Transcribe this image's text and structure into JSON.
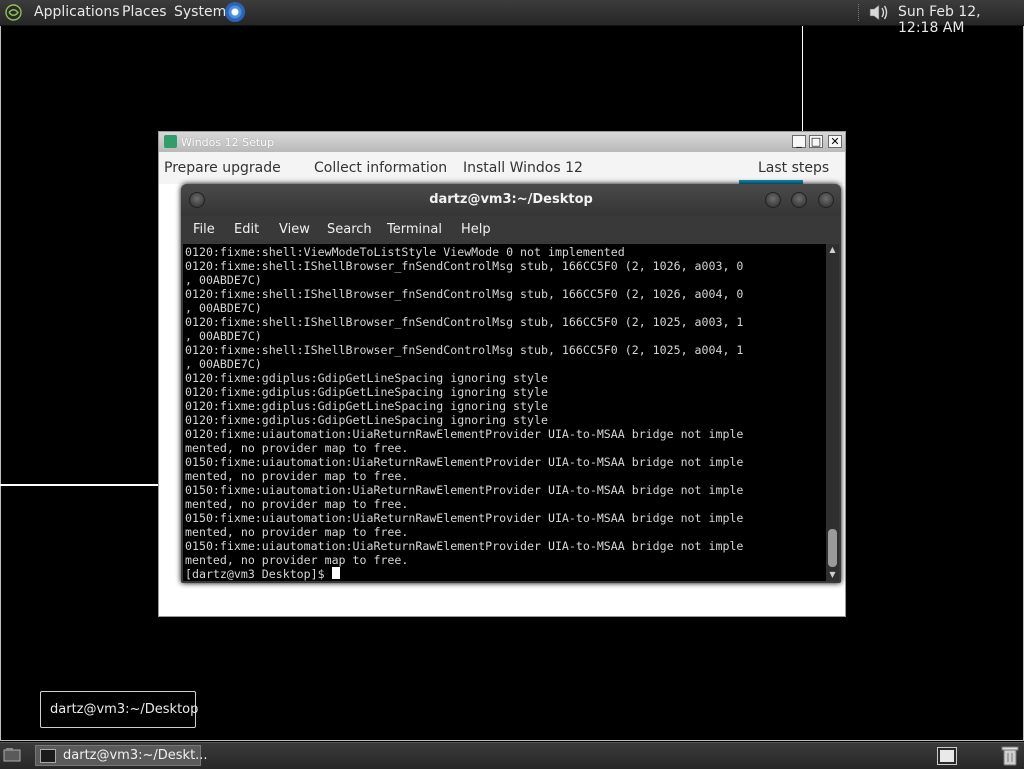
{
  "top_panel": {
    "menus": [
      "Applications",
      "Places",
      "System"
    ],
    "clock": "Sun Feb 12, 12:18 AM",
    "icons": [
      "mate-logo-icon",
      "browser-icon",
      "volume-icon"
    ]
  },
  "setup_window": {
    "title": "Windos 12 Setup",
    "steps": [
      "Prepare upgrade",
      "Collect information",
      "Install Windos 12",
      "Last steps"
    ],
    "active_step_index": 3,
    "buttons": {
      "minimize": "_",
      "maximize": "□",
      "close": "✕"
    }
  },
  "terminal": {
    "title": "dartz@vm3:~/Desktop",
    "menu": [
      "File",
      "Edit",
      "View",
      "Search",
      "Terminal",
      "Help"
    ],
    "lines": [
      "0120:fixme:shell:ViewModeToListStyle ViewMode 0 not implemented",
      "0120:fixme:shell:IShellBrowser_fnSendControlMsg stub, 166CC5F0 (2, 1026, a003, 0",
      ", 00ABDE7C)",
      "0120:fixme:shell:IShellBrowser_fnSendControlMsg stub, 166CC5F0 (2, 1026, a004, 0",
      ", 00ABDE7C)",
      "0120:fixme:shell:IShellBrowser_fnSendControlMsg stub, 166CC5F0 (2, 1025, a003, 1",
      ", 00ABDE7C)",
      "0120:fixme:shell:IShellBrowser_fnSendControlMsg stub, 166CC5F0 (2, 1025, a004, 1",
      ", 00ABDE7C)",
      "0120:fixme:gdiplus:GdipGetLineSpacing ignoring style",
      "0120:fixme:gdiplus:GdipGetLineSpacing ignoring style",
      "0120:fixme:gdiplus:GdipGetLineSpacing ignoring style",
      "0120:fixme:gdiplus:GdipGetLineSpacing ignoring style",
      "0120:fixme:uiautomation:UiaReturnRawElementProvider UIA-to-MSAA bridge not imple",
      "mented, no provider map to free.",
      "0150:fixme:uiautomation:UiaReturnRawElementProvider UIA-to-MSAA bridge not imple",
      "mented, no provider map to free.",
      "0150:fixme:uiautomation:UiaReturnRawElementProvider UIA-to-MSAA bridge not imple",
      "mented, no provider map to free.",
      "0150:fixme:uiautomation:UiaReturnRawElementProvider UIA-to-MSAA bridge not imple",
      "mented, no provider map to free.",
      "0150:fixme:uiautomation:UiaReturnRawElementProvider UIA-to-MSAA bridge not imple",
      "mented, no provider map to free."
    ],
    "prompt": "[dartz@vm3 Desktop]$ "
  },
  "tooltip": {
    "text": "dartz@vm3:~/Desktop"
  },
  "bottom_panel": {
    "taskbar_item": "dartz@vm3:~/Deskt...",
    "icons": [
      "show-desktop-icon",
      "terminal-icon",
      "workspace-switcher-icon",
      "trash-icon"
    ]
  },
  "colors": {
    "desktop_bg": "#000000",
    "panel_bg": "#2f2f2f",
    "step_accent": "#138bb0",
    "terminal_bg": "#000000",
    "terminal_text": "#d6d6d6"
  }
}
